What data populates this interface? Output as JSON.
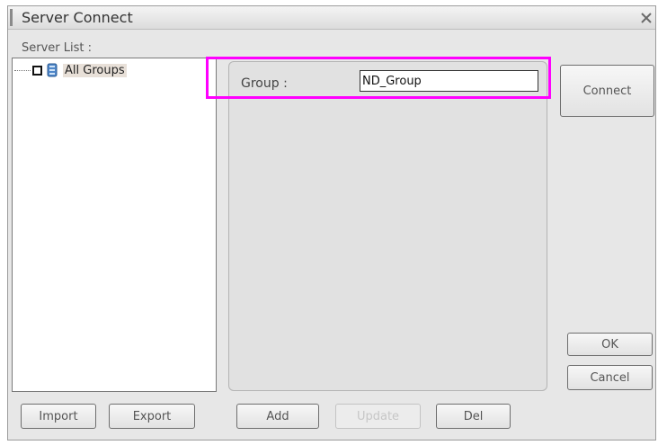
{
  "window": {
    "title": "Server Connect"
  },
  "icons": {
    "close": "close-icon",
    "server_group": "server-group-icon"
  },
  "server_list": {
    "label": "Server List :",
    "tree": [
      {
        "label": "All Groups",
        "checked": false
      }
    ]
  },
  "group_form": {
    "label": "Group :",
    "value": "ND_Group"
  },
  "buttons": {
    "connect": "Connect",
    "ok": "OK",
    "cancel": "Cancel",
    "import": "Import",
    "export": "Export",
    "add": "Add",
    "update": "Update",
    "del": "Del"
  },
  "colors": {
    "highlight": "#ff00ff"
  }
}
